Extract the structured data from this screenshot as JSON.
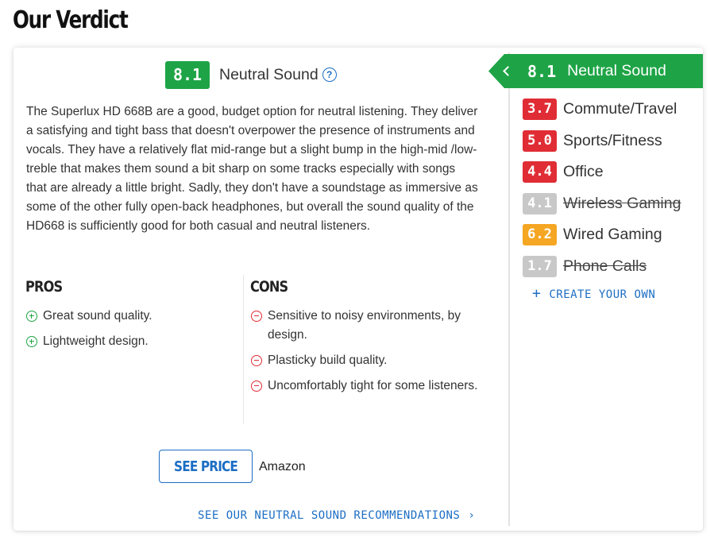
{
  "page": {
    "title": "Our Verdict"
  },
  "verdict": {
    "score": "8.1",
    "label": "Neutral Sound",
    "description": "The Superlux HD 668B are a good, budget option for neutral listening. They deliver a satisfying and tight bass that doesn't overpower the presence of instruments and vocals. They have a relatively flat mid-range but a slight bump in the high-mid /low-treble that makes them sound a bit sharp on some tracks especially with songs that are already a little bright. Sadly, they don't have a soundstage as immersive as some of the other fully open-back headphones, but overall the sound quality of the HD668 is sufficiently good for both casual and neutral listeners."
  },
  "pros": {
    "title": "PROS",
    "items": [
      "Great sound quality.",
      "Lightweight design."
    ]
  },
  "cons": {
    "title": "CONS",
    "items": [
      "Sensitive to noisy environments, by design.",
      "Plasticky build quality.",
      "Uncomfortably tight for some listeners."
    ]
  },
  "purchase": {
    "button_label": "SEE PRICE",
    "store": "Amazon"
  },
  "recommendations_link": {
    "label": "SEE OUR NEUTRAL SOUND RECOMMENDATIONS",
    "icon": "chevron-right-icon"
  },
  "sidebar": {
    "active": {
      "score": "8.1",
      "label": "Neutral Sound",
      "color": "#1ea446",
      "icon": "chevron-left-icon"
    },
    "items": [
      {
        "score": "3.7",
        "label": "Commute/Travel",
        "color": "#e02d35",
        "disabled": false
      },
      {
        "score": "5.0",
        "label": "Sports/Fitness",
        "color": "#e02d35",
        "disabled": false
      },
      {
        "score": "4.4",
        "label": "Office",
        "color": "#e02d35",
        "disabled": false
      },
      {
        "score": "4.1",
        "label": "Wireless Gaming",
        "color": "#c8c8c8",
        "disabled": true
      },
      {
        "score": "6.2",
        "label": "Wired Gaming",
        "color": "#f5a623",
        "disabled": false
      },
      {
        "score": "1.7",
        "label": "Phone Calls",
        "color": "#c8c8c8",
        "disabled": true
      }
    ],
    "create_label": "CREATE YOUR OWN"
  },
  "colors": {
    "accent": "#1c6ec4",
    "good": "#1ea446",
    "bad": "#e02d35",
    "mid": "#f5a623",
    "disabled": "#c8c8c8"
  }
}
